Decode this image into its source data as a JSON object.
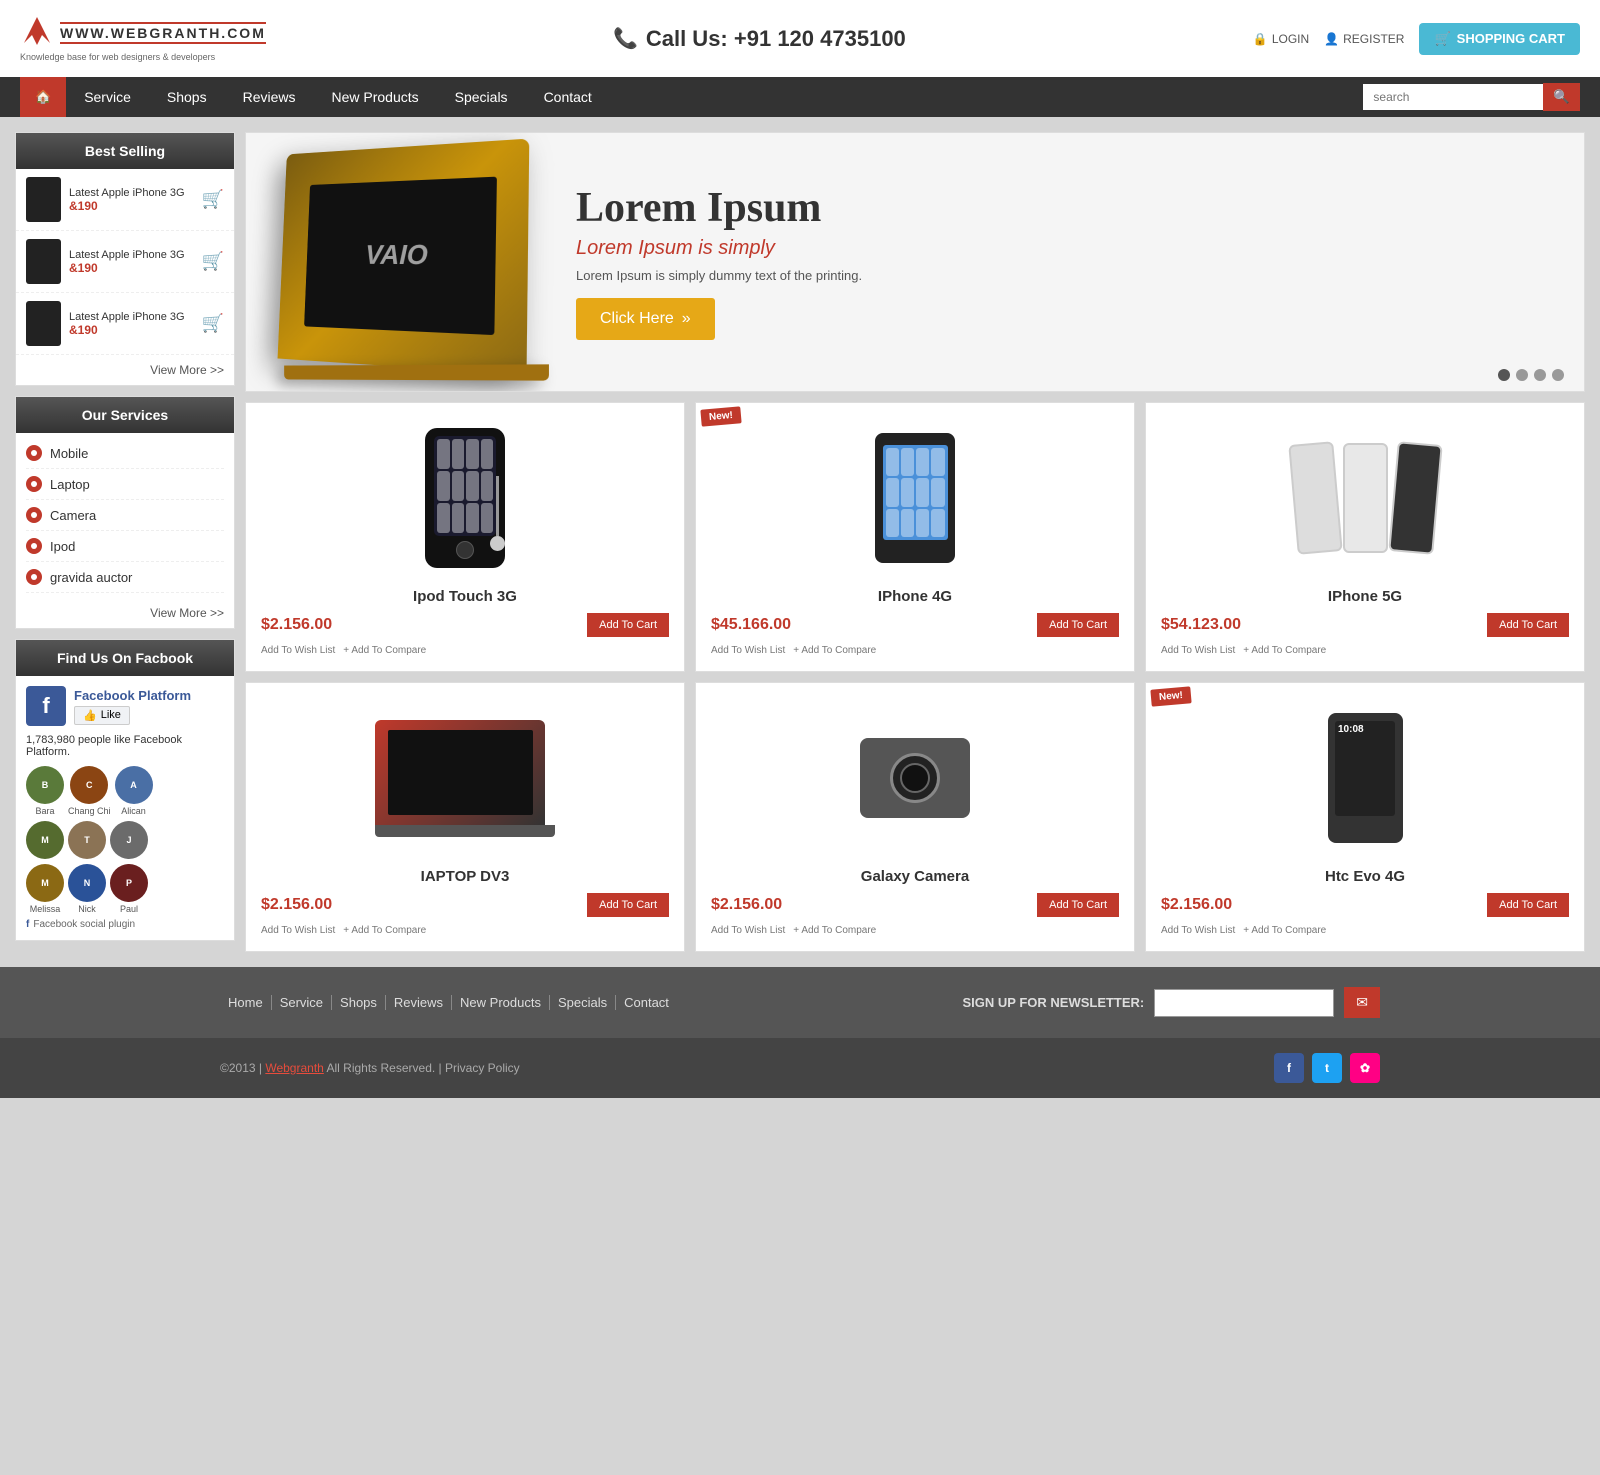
{
  "site": {
    "logo_brand": "WWW.WEBGRANTH.COM",
    "logo_tagline": "Knowledge base for web designers & developers",
    "phone_label": "Call Us:",
    "phone_number": "+91 120 4735100",
    "login_label": "LOGIN",
    "register_label": "REGISTER",
    "cart_label": "SHOPPING CART"
  },
  "nav": {
    "home_icon": "home-icon",
    "items": [
      {
        "label": "Service",
        "id": "service"
      },
      {
        "label": "Shops",
        "id": "shops"
      },
      {
        "label": "Reviews",
        "id": "reviews"
      },
      {
        "label": "New Products",
        "id": "new-products"
      },
      {
        "label": "Specials",
        "id": "specials"
      },
      {
        "label": "Contact",
        "id": "contact"
      }
    ],
    "search_placeholder": "search"
  },
  "sidebar": {
    "best_selling_title": "Best Selling",
    "best_selling_products": [
      {
        "name": "Latest Apple iPhone 3G",
        "price": "&190"
      },
      {
        "name": "Latest Apple iPhone 3G",
        "price": "&190"
      },
      {
        "name": "Latest Apple iPhone 3G",
        "price": "&190"
      }
    ],
    "view_more_label": "View More >>",
    "services_title": "Our Services",
    "services": [
      {
        "label": "Mobile"
      },
      {
        "label": "Laptop"
      },
      {
        "label": "Camera"
      },
      {
        "label": "Ipod"
      },
      {
        "label": "gravida auctor"
      }
    ],
    "services_view_more": "View More >>",
    "facebook_title": "Find Us On Facbook",
    "fb_name": "Facebook Platform",
    "fb_like_label": "Like",
    "fb_count": "1,783,980 people like Facebook Platform.",
    "fb_users": [
      {
        "name": "Bara",
        "color": "#5a7a3a"
      },
      {
        "name": "Chang Chi",
        "color": "#8b4513"
      },
      {
        "name": "Alican",
        "color": "#4a6fa5"
      },
      {
        "name": "",
        "color": "#333"
      },
      {
        "name": "",
        "color": "#555"
      },
      {
        "name": "",
        "color": "#666"
      },
      {
        "name": "Melissa",
        "color": "#8b6914"
      },
      {
        "name": "Nick",
        "color": "#2a5298"
      },
      {
        "name": "Paul",
        "color": "#6a1f1f"
      }
    ],
    "fb_plugin_label": "Facebook social plugin"
  },
  "hero": {
    "title": "Lorem Ipsum",
    "subtitle": "Lorem Ipsum is simply",
    "description": "Lorem Ipsum is simply dummy text of the printing.",
    "button_label": "Click Here",
    "dots": [
      true,
      false,
      false,
      false
    ]
  },
  "products": [
    {
      "id": "ipod-touch-3g",
      "title": "Ipod Touch 3G",
      "price": "$2.156.00",
      "add_cart": "Add To Cart",
      "wish": "Add To Wish List",
      "compare": "+ Add To Compare",
      "new_badge": false,
      "type": "ipod"
    },
    {
      "id": "iphone-4g",
      "title": "IPhone 4G",
      "price": "$45.166.00",
      "add_cart": "Add To Cart",
      "wish": "Add To Wish List",
      "compare": "+ Add To Compare",
      "new_badge": true,
      "type": "iphone4"
    },
    {
      "id": "iphone-5g",
      "title": "IPhone 5G",
      "price": "$54.123.00",
      "add_cart": "Add To Cart",
      "wish": "Add To Wish List",
      "compare": "+ Add To Compare",
      "new_badge": false,
      "type": "iphone5"
    },
    {
      "id": "laptop-dv3",
      "title": "IAPTOP DV3",
      "price": "$2.156.00",
      "add_cart": "Add To Cart",
      "wish": "Add To Wish List",
      "compare": "+ Add To Compare",
      "new_badge": false,
      "type": "laptop"
    },
    {
      "id": "galaxy-camera",
      "title": "Galaxy Camera",
      "price": "$2.156.00",
      "add_cart": "Add To Cart",
      "wish": "Add To Wish List",
      "compare": "+ Add To Compare",
      "new_badge": false,
      "type": "camera"
    },
    {
      "id": "htc-evo-4g",
      "title": "Htc Evo 4G",
      "price": "$2.156.00",
      "add_cart": "Add To Cart",
      "wish": "Add To Wish List",
      "compare": "+ Add To Compare",
      "new_badge": true,
      "type": "htc"
    }
  ],
  "footer": {
    "links": [
      {
        "label": "Home"
      },
      {
        "label": "Service"
      },
      {
        "label": "Shops"
      },
      {
        "label": "Reviews"
      },
      {
        "label": "New Products"
      },
      {
        "label": "Specials"
      },
      {
        "label": "Contact"
      }
    ],
    "newsletter_label": "SIGN UP FOR NEWSLETTER:",
    "newsletter_placeholder": "",
    "copyright": "©2013 |",
    "brand_link": "Webgranth",
    "rights": "All Rights Reserved. | Privacy Policy",
    "social": [
      {
        "label": "f",
        "name": "facebook",
        "class": "social-fb"
      },
      {
        "label": "t",
        "name": "twitter",
        "class": "social-tw"
      },
      {
        "label": "✿",
        "name": "flickr",
        "class": "social-fl"
      }
    ]
  }
}
